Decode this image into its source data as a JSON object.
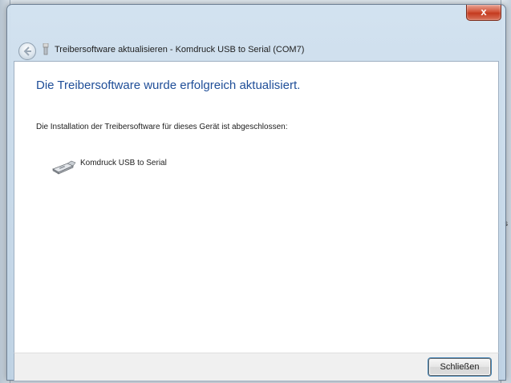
{
  "window": {
    "title": "Treibersoftware aktualisieren - Komdruck USB to Serial (COM7)",
    "close_glyph": "x"
  },
  "content": {
    "heading": "Die Treibersoftware wurde erfolgreich aktualisiert.",
    "message": "Die Installation der Treibersoftware für dieses Gerät ist abgeschlossen:",
    "device_name": "Komdruck USB to Serial",
    "device_icon": "usb-serial-device-icon"
  },
  "footer": {
    "close_label": "Schließen"
  },
  "background": {
    "right_char": "s"
  },
  "colors": {
    "heading": "#1f4e98",
    "close_button": "#c43a1f"
  }
}
